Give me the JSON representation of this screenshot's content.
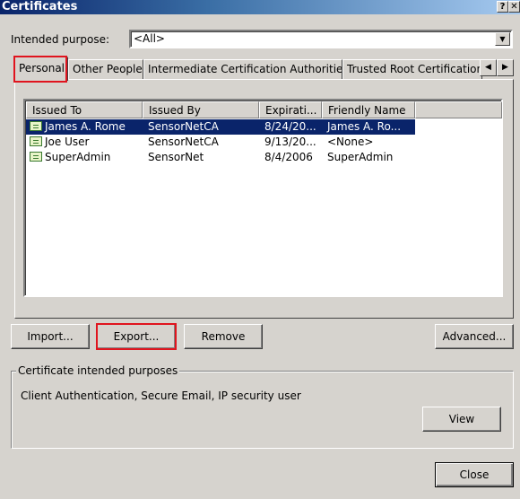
{
  "window": {
    "title": "Certificates",
    "help_label": "?",
    "close_label": "✕"
  },
  "intended_purpose": {
    "label": "Intended purpose:",
    "value": "<All>",
    "dropdown_icon": "triangle-down"
  },
  "tabs": [
    {
      "label": "Personal",
      "active": true
    },
    {
      "label": "Other People",
      "active": false
    },
    {
      "label": "Intermediate Certification Authorities",
      "active": false
    },
    {
      "label": "Trusted Root Certification Authorities",
      "active": false
    }
  ],
  "tab_scroll": {
    "left_icon": "◀",
    "right_icon": "▶"
  },
  "list": {
    "columns": [
      "Issued To",
      "Issued By",
      "Expirati...",
      "Friendly Name"
    ],
    "rows": [
      {
        "issued_to": "James A. Rome",
        "issued_by": "SensorNetCA",
        "expiration": "8/24/20...",
        "friendly_name": "James A. Ro...",
        "selected": true
      },
      {
        "issued_to": "Joe User",
        "issued_by": "SensorNetCA",
        "expiration": "9/13/20...",
        "friendly_name": "<None>",
        "selected": false
      },
      {
        "issued_to": "SuperAdmin",
        "issued_by": "SensorNet",
        "expiration": "8/4/2006",
        "friendly_name": "SuperAdmin",
        "selected": false
      }
    ]
  },
  "buttons": {
    "import": "Import...",
    "export": "Export...",
    "remove": "Remove",
    "advanced": "Advanced...",
    "view": "View",
    "close": "Close"
  },
  "purposes": {
    "title": "Certificate intended purposes",
    "text": "Client Authentication, Secure Email, IP security user"
  },
  "colors": {
    "highlight": "#e0141e",
    "selection": "#0a246a",
    "dialog_bg": "#d6d3ce"
  }
}
